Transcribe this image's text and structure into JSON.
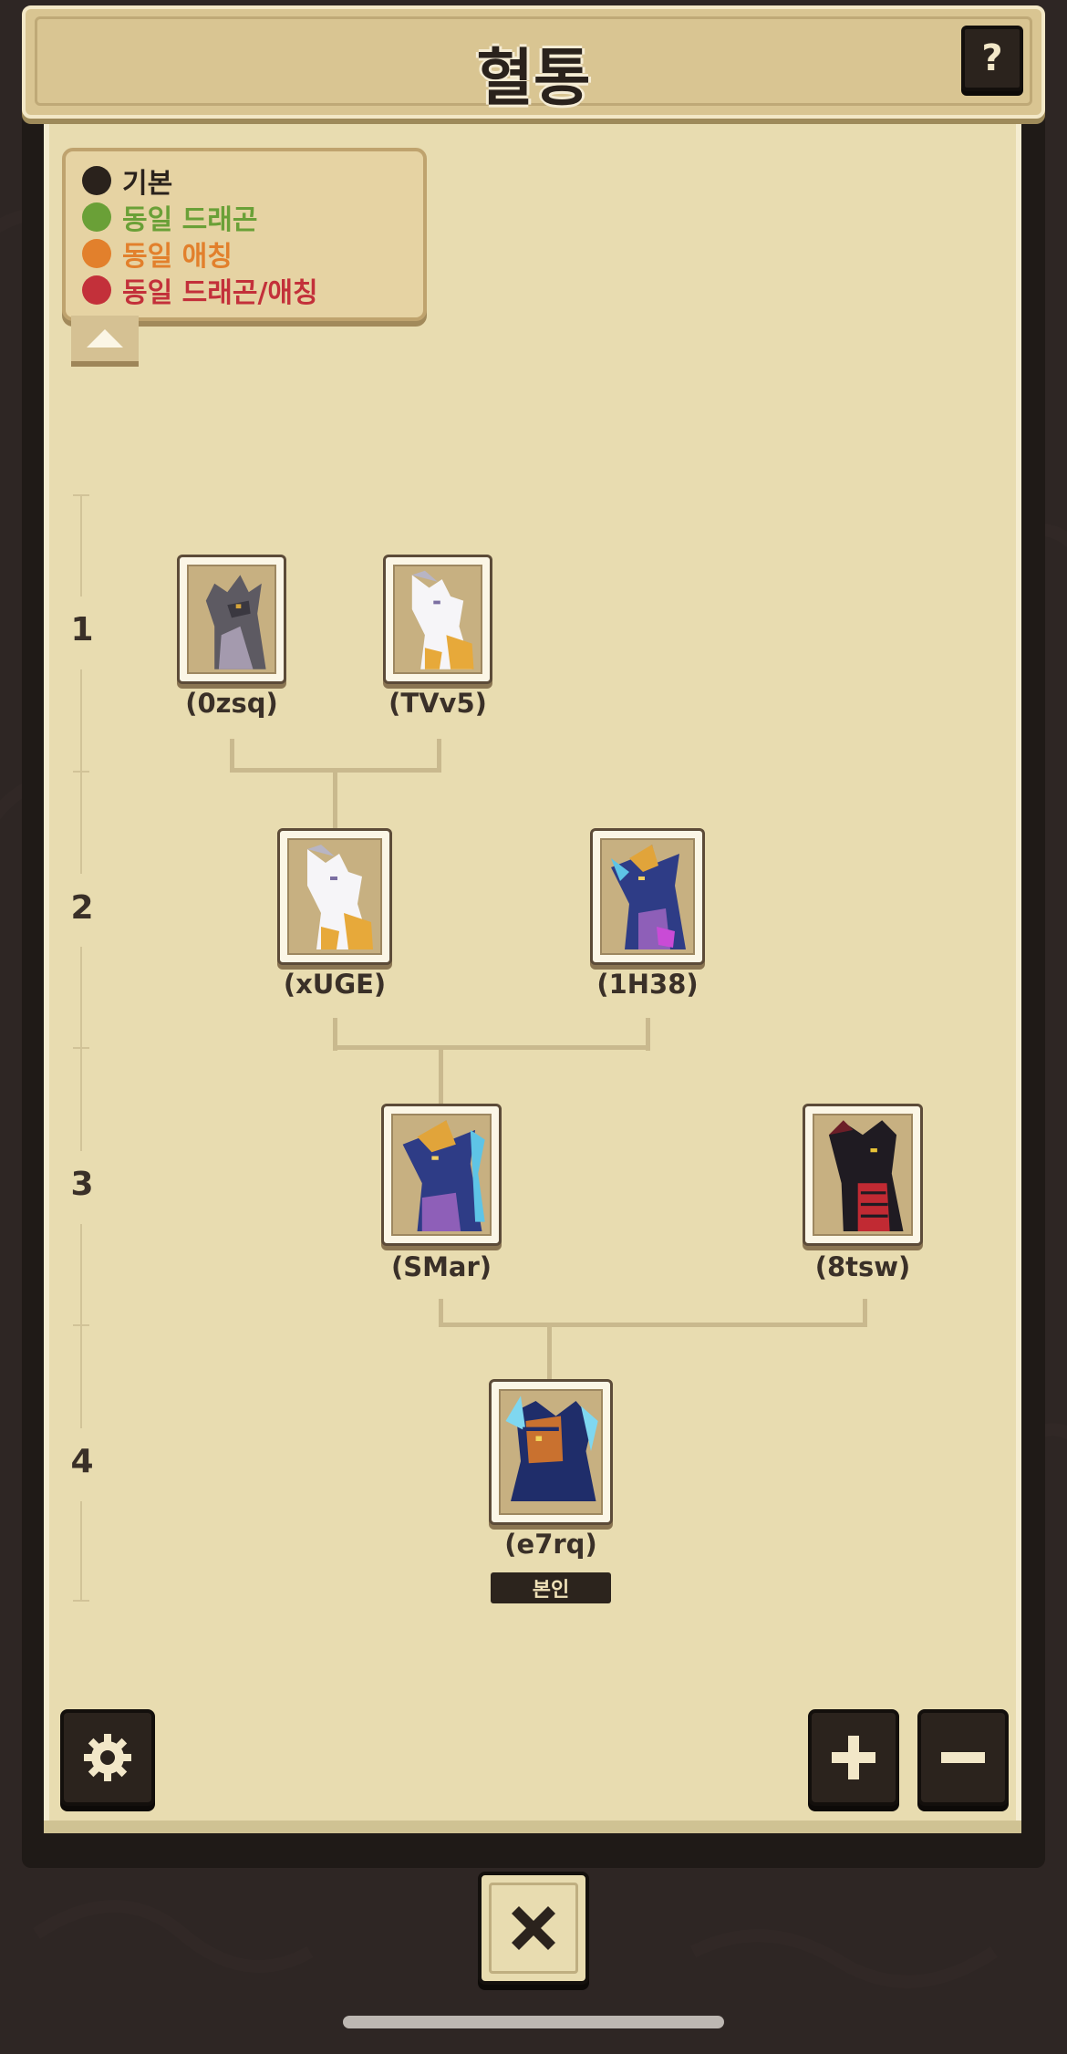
{
  "header": {
    "title": "혈통",
    "help_label": "?"
  },
  "legend": {
    "items": [
      {
        "label": "기본",
        "color": "#2a221c"
      },
      {
        "label": "동일 드래곤",
        "color": "#6aa037"
      },
      {
        "label": "동일 애칭",
        "color": "#e2802c"
      },
      {
        "label": "동일 드래곤/애칭",
        "color": "#c3303a"
      }
    ]
  },
  "generations": [
    "1",
    "2",
    "3",
    "4"
  ],
  "tree": {
    "gen1": [
      {
        "label": "(0zsq)",
        "dragon_icon": "gray-dragon-icon"
      },
      {
        "label": "(TVv5)",
        "dragon_icon": "white-gold-dragon-icon"
      }
    ],
    "gen2": [
      {
        "label": "(xUGE)",
        "dragon_icon": "white-gold-dragon-icon"
      },
      {
        "label": "(1H38)",
        "dragon_icon": "blue-gold-dragon-icon"
      }
    ],
    "gen3": [
      {
        "label": "(SMar)",
        "dragon_icon": "blue-gold-dragon-icon"
      },
      {
        "label": "(8tsw)",
        "dragon_icon": "black-red-dragon-icon"
      }
    ],
    "gen4": [
      {
        "label": "(e7rq)",
        "dragon_icon": "navy-orange-dragon-icon",
        "badge": "본인"
      }
    ]
  },
  "controls": {
    "settings_icon": "gear-icon",
    "zoom_in_icon": "plus-icon",
    "zoom_out_icon": "minus-icon",
    "close_icon": "close-icon"
  },
  "colors": {
    "paper": "#e8dcb0",
    "panel": "#1f1a17",
    "header": "#d9c592",
    "dark_button": "#2b231d"
  }
}
